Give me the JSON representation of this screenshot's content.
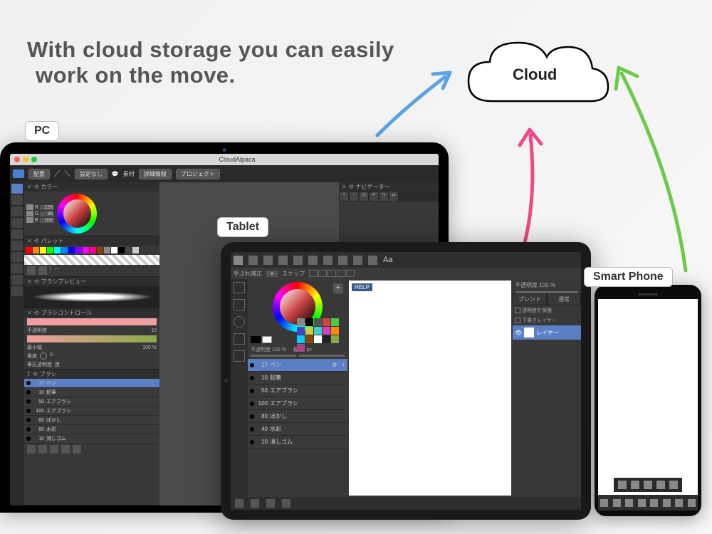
{
  "heading": {
    "line1": "With cloud storage you can easily",
    "line2": "work on the move."
  },
  "cloud_label": "Cloud",
  "badges": {
    "pc": "PC",
    "tablet": "Tablet",
    "phone": "Smart Phone"
  },
  "laptop": {
    "app_title": "CloudAlpaca",
    "toolbar": {
      "layout": "配置",
      "settings": "設定なし",
      "material": "素材",
      "info": "詳細情報",
      "project": "プロジェクト"
    },
    "panels": {
      "color_title": "カラー",
      "rgb": {
        "r_label": "R",
        "r": "228",
        "g_label": "G",
        "g": "36",
        "b_label": "B",
        "b": "100"
      },
      "palette_title": "パレット",
      "brush_preview_title": "ブラシプレビュー",
      "brush_control_title": "ブラシコントロール",
      "opacity_label": "不透明度",
      "opacity_val": "10",
      "min_width_label": "最小幅",
      "min_width_val": "100 %",
      "angle_label": "角度",
      "angle_val": "0",
      "pressure_label": "筆圧透明度",
      "pressure_val": "度",
      "brush_title": "ブラシ",
      "navigator_title": "ナビゲーター"
    },
    "brushes": [
      {
        "size": "17",
        "name": "ペン"
      },
      {
        "size": "10",
        "name": "鉛筆"
      },
      {
        "size": "50",
        "name": "エアブラシ"
      },
      {
        "size": "100",
        "name": "エアブラシ"
      },
      {
        "size": "80",
        "name": "ぼかし"
      },
      {
        "size": "80",
        "name": "水彩"
      },
      {
        "size": "10",
        "name": "消しゴム"
      }
    ]
  },
  "tablet": {
    "subbar": {
      "correction": "手ぶれ補正",
      "snap": "スナップ"
    },
    "sliders": {
      "opacity": "不透明度 100 %",
      "width": "幅 17 px"
    },
    "help": "HELP",
    "text_tool": "Aa",
    "brushes": [
      {
        "size": "17",
        "name": "ペン"
      },
      {
        "size": "10",
        "name": "鉛筆"
      },
      {
        "size": "50",
        "name": "エアブラシ"
      },
      {
        "size": "100",
        "name": "エアブラシ"
      },
      {
        "size": "80",
        "name": "ぼかし"
      },
      {
        "size": "40",
        "name": "水彩"
      },
      {
        "size": "10",
        "name": "消しゴム"
      }
    ],
    "layers": {
      "opacity": "不透明度 100 %",
      "blend": "ブレンド",
      "normal": "通常",
      "protect_alpha": "透明度を保護",
      "draft": "下書きレイヤー",
      "layer_name": "レイヤー"
    }
  },
  "palette_colors": [
    "#ff0000",
    "#ff8800",
    "#ffff00",
    "#00ff00",
    "#00ffff",
    "#0088ff",
    "#0000ff",
    "#8800ff",
    "#ff00ff",
    "#ff0088",
    "#884400",
    "#888888",
    "#ffffff",
    "#000000",
    "#444444",
    "#cccccc"
  ],
  "tablet_palette": [
    "#888",
    "#000",
    "#555",
    "#c44",
    "#4c4",
    "#44c",
    "#cc4",
    "#4cc",
    "#c4c",
    "#f80",
    "#0cf",
    "#840",
    "#fff",
    "#222",
    "#8a4",
    "#a48"
  ]
}
